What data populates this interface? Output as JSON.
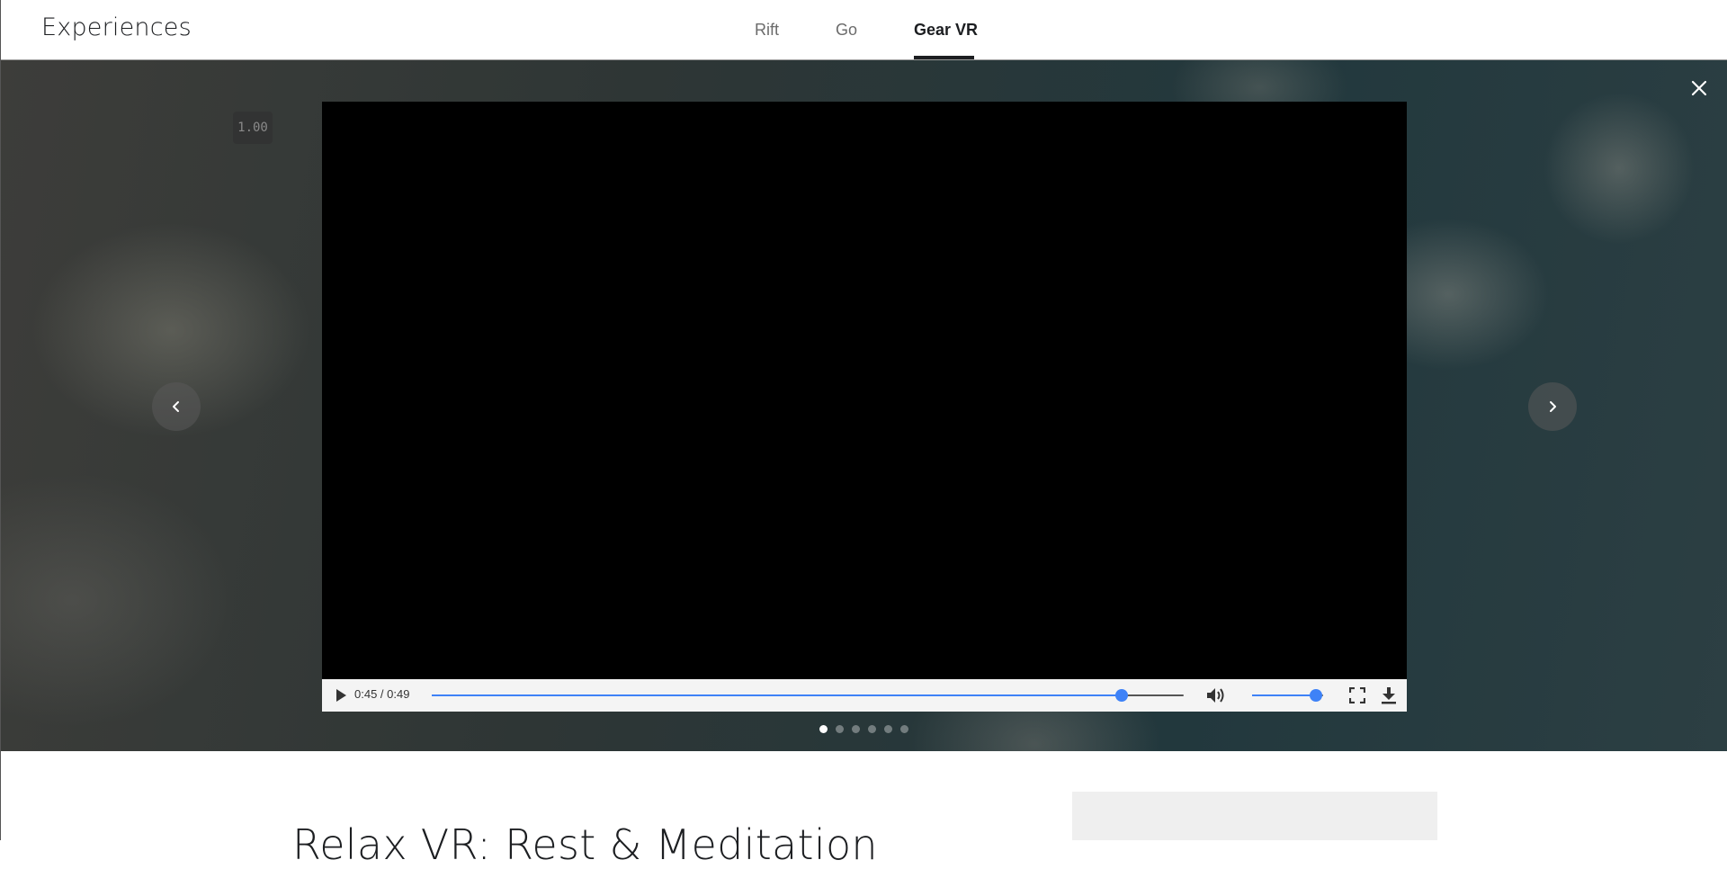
{
  "header": {
    "brand": "Experiences",
    "tabs": [
      {
        "label": "Rift",
        "active": false
      },
      {
        "label": "Go",
        "active": false
      },
      {
        "label": "Gear VR",
        "active": true
      }
    ]
  },
  "gallery": {
    "speed_badge": "1.00",
    "close_icon": "close-icon",
    "prev_icon": "chevron-left-icon",
    "next_icon": "chevron-right-icon",
    "video": {
      "time_display": "0:45 / 0:49",
      "progress_fraction": 0.918,
      "volume_fraction": 0.9,
      "controls": [
        "play-icon",
        "volume-icon",
        "fullscreen-icon",
        "download-icon"
      ],
      "accent_color": "#3e82f7"
    },
    "dots": {
      "count": 6,
      "active_index": 0
    }
  },
  "app": {
    "title": "Relax VR: Rest & Meditation"
  }
}
